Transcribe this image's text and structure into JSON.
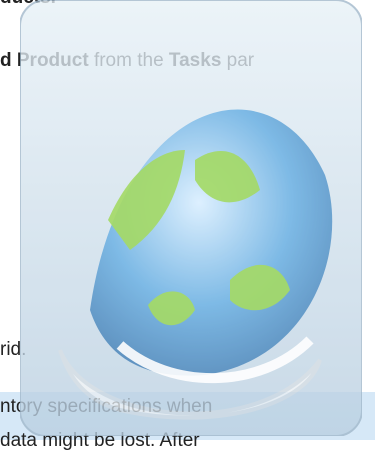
{
  "document": {
    "top_fragment": "ducts.",
    "step_prefix": "d Product",
    "step_middle": " from the ",
    "step_tasks": "Tasks",
    "step_suffix": " par",
    "grid_fragment": "rid.",
    "note_line1": "ntory specifications when",
    "note_line2": "data might be lost. After"
  },
  "icon": {
    "name": "app-icon-watermark",
    "colors": {
      "sky": "#c9dde9",
      "blue": "#4f9ed8",
      "green": "#8bcf3d",
      "tray": "#f1f3f4"
    }
  }
}
